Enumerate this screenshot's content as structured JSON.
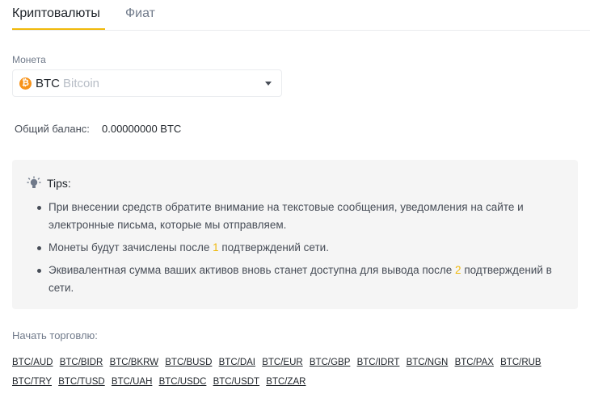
{
  "tabs": {
    "crypto": "Криптовалюты",
    "fiat": "Фиат"
  },
  "coin": {
    "label": "Монета",
    "symbol": "BTC",
    "name": "Bitcoin",
    "icon_glyph": "₿",
    "icon": "bitcoin-icon"
  },
  "balance": {
    "label": "Общий баланс:",
    "value": "0.00000000 BTC"
  },
  "tips": {
    "title": "Tips:",
    "icon": "lightbulb-icon",
    "items": [
      {
        "before": "При внесении средств обратите внимание на текстовые сообщения, уведомления на сайте и электронные письма, которые мы отправляем.",
        "highlight": "",
        "after": ""
      },
      {
        "before": "Монеты будут зачислены после ",
        "highlight": "1",
        "after": " подтверждений сети."
      },
      {
        "before": "Эквивалентная сумма ваших активов вновь станет доступна для вывода после ",
        "highlight": "2",
        "after": " подтверждений в сети."
      }
    ]
  },
  "trade": {
    "label": "Начать торговлю:",
    "pairs": [
      "BTC/AUD",
      "BTC/BIDR",
      "BTC/BKRW",
      "BTC/BUSD",
      "BTC/DAI",
      "BTC/EUR",
      "BTC/GBP",
      "BTC/IDRT",
      "BTC/NGN",
      "BTC/PAX",
      "BTC/RUB",
      "BTC/TRY",
      "BTC/TUSD",
      "BTC/UAH",
      "BTC/USDC",
      "BTC/USDT",
      "BTC/ZAR"
    ]
  },
  "colors": {
    "accent": "#f0b90b",
    "bitcoin": "#f7931a"
  }
}
